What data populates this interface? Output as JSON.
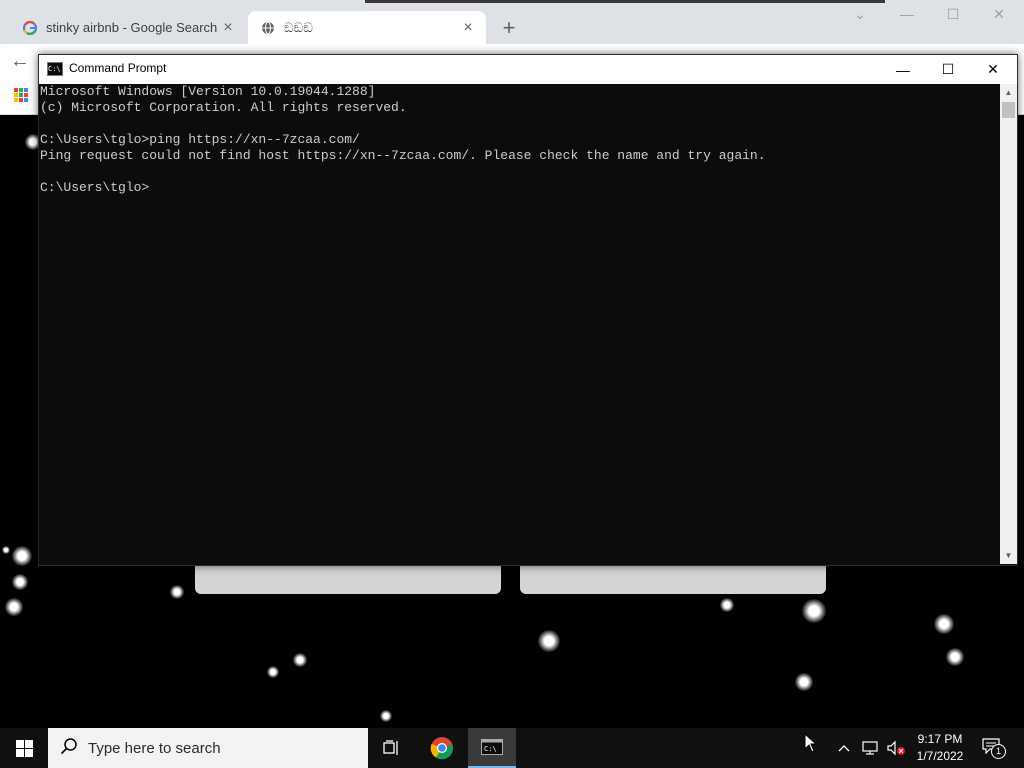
{
  "browser": {
    "tabs": [
      {
        "title": "stinky airbnb - Google Search",
        "favicon": "google-g-icon",
        "active": false
      },
      {
        "title": "ඞඞඞ",
        "favicon": "globe-icon",
        "active": true
      }
    ],
    "new_tab_icon": "+",
    "close_icon": "×"
  },
  "cmd": {
    "title": "Command Prompt",
    "lines": [
      "Microsoft Windows [Version 10.0.19044.1288]",
      "(c) Microsoft Corporation. All rights reserved.",
      "",
      "C:\\Users\\tglo>ping https://xn--7zcaa.com/",
      "Ping request could not find host https://xn--7zcaa.com/. Please check the name and try again.",
      "",
      "C:\\Users\\tglo>"
    ],
    "minimize": "—",
    "maximize": "☐",
    "close": "✕"
  },
  "taskbar": {
    "search_placeholder": "Type here to search",
    "time": "9:17 PM",
    "date": "1/7/2022",
    "notification_count": "1"
  }
}
